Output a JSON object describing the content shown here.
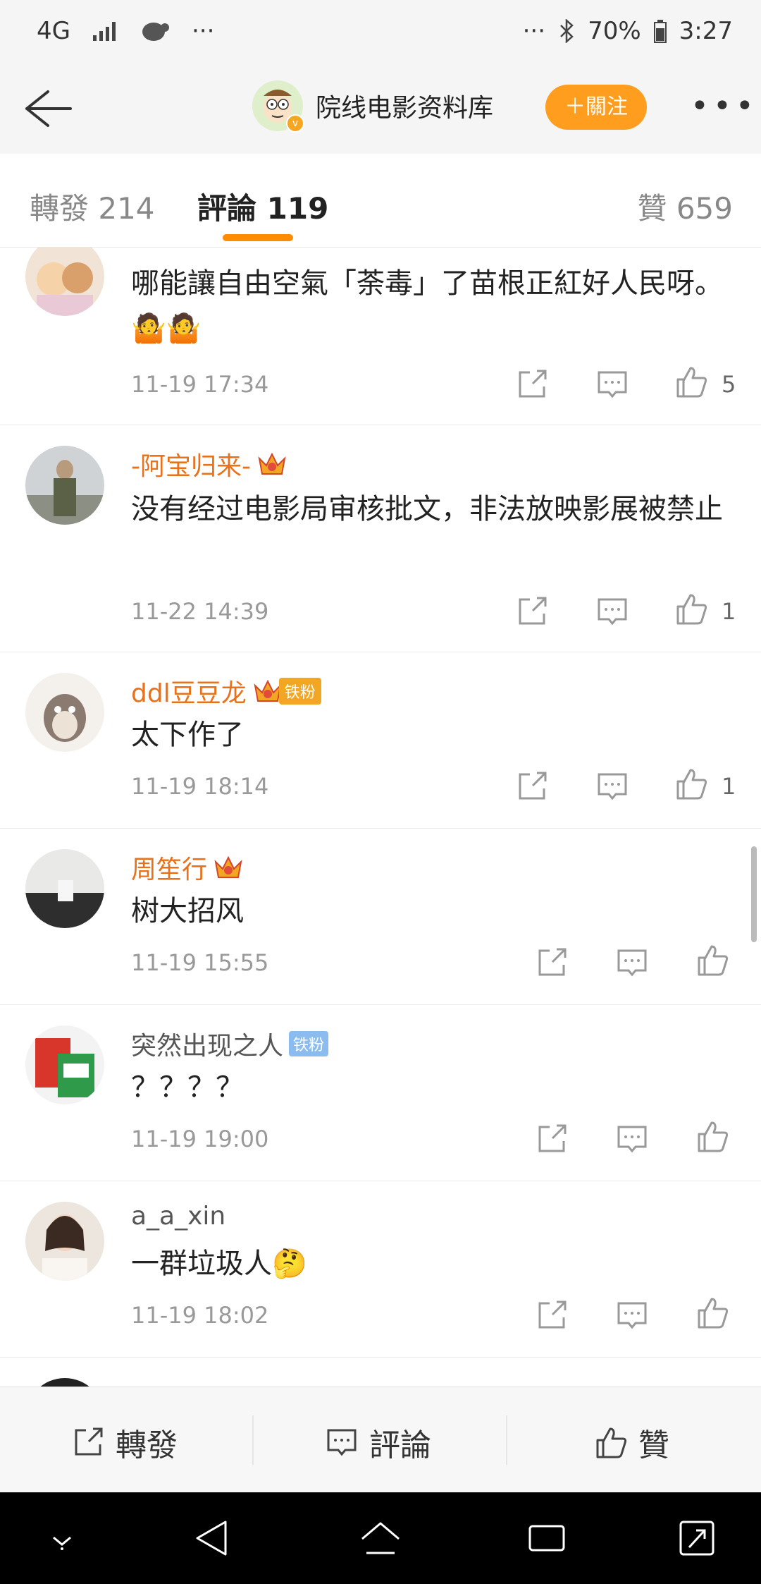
{
  "status_bar": {
    "network": "4G",
    "dots_left": "···",
    "dots_right": "···",
    "battery": "70%",
    "time": "3:27"
  },
  "header": {
    "title": "院线电影资料库",
    "follow_label": "＋關注"
  },
  "tabs": [
    {
      "label": "轉發 214"
    },
    {
      "label": "評論 119"
    },
    {
      "label": "贊 659"
    }
  ],
  "comments": [
    {
      "text": "哪能讓自由空氣「荼毒」了苗根正紅好人民呀。",
      "time": "11-19 17:34",
      "likes": "5"
    },
    {
      "name": "-阿宝归来-",
      "text": "没有经过电影局审核批文，非法放映影展被禁止",
      "time": "11-22 14:39",
      "likes": "1"
    },
    {
      "name": "ddl豆豆龙",
      "badge": "铁粉",
      "text": "太下作了",
      "time": "11-19 18:14",
      "likes": "1"
    },
    {
      "name": "周笙行",
      "text": "树大招风",
      "time": "11-19 15:55",
      "likes": ""
    },
    {
      "name": "突然出现之人",
      "badge": "铁粉",
      "text": "？？？？",
      "time": "11-19 19:00",
      "likes": ""
    },
    {
      "name": "a_a_xin",
      "text": "一群垃圾人",
      "time": "11-19 18:02",
      "likes": ""
    }
  ],
  "bottom_bar": {
    "repost": "轉發",
    "comment": "評論",
    "like": "贊"
  },
  "colors": {
    "accent": "#ff9d1f",
    "name_orange": "#e8711a",
    "fan_badge_blue": "#8bbcf0"
  }
}
